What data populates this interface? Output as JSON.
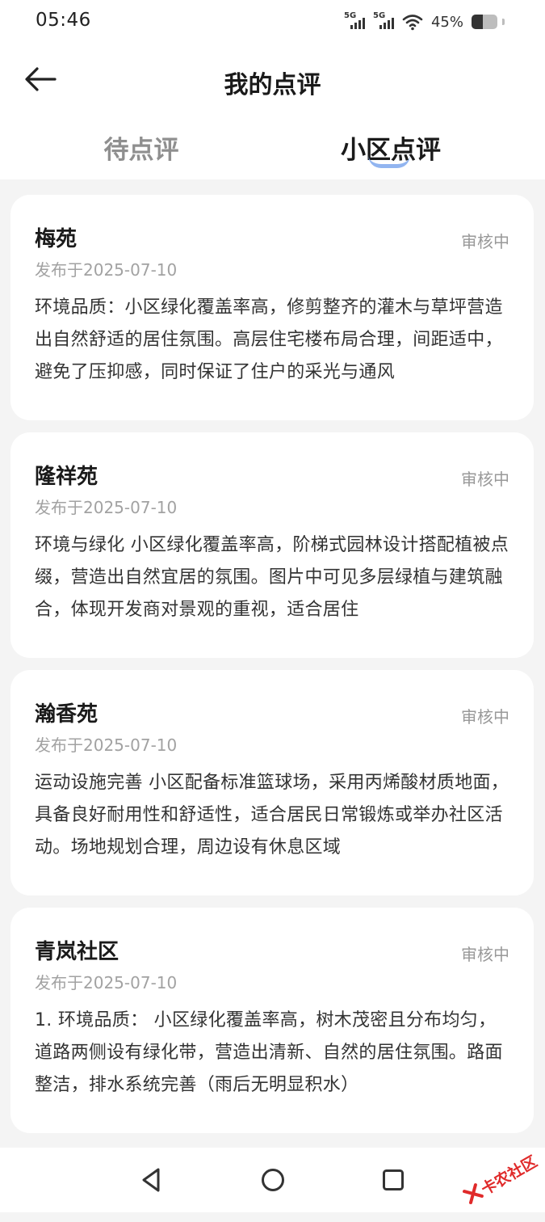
{
  "status_bar": {
    "time": "05:46",
    "signal_1_label": "5G",
    "signal_2_label": "5G",
    "battery_percent": "45%",
    "battery_level": 0.45
  },
  "header": {
    "title": "我的点评",
    "back_icon": "arrow-left-icon"
  },
  "tabs": [
    {
      "label": "待点评",
      "active": false
    },
    {
      "label": "小区点评",
      "active": true
    }
  ],
  "reviews": [
    {
      "name": "梅苑",
      "status": "审核中",
      "date": "发布于2025-07-10",
      "text": "环境品质：小区绿化覆盖率高，修剪整齐的灌木与草坪营造出自然舒适的居住氛围。高层住宅楼布局合理，间距适中，避免了压抑感，同时保证了住户的采光与通风"
    },
    {
      "name": "隆祥苑",
      "status": "审核中",
      "date": "发布于2025-07-10",
      "text": "环境与绿化 小区绿化覆盖率高，阶梯式园林设计搭配植被点缀，营造出自然宜居的氛围。图片中可见多层绿植与建筑融合，体现开发商对景观的重视，适合居住"
    },
    {
      "name": "瀚香苑",
      "status": "审核中",
      "date": "发布于2025-07-10",
      "text": "运动设施完善 小区配备标准篮球场，采用丙烯酸材质地面，具备良好耐用性和舒适性，适合居民日常锻炼或举办社区活动。场地规划合理，周边设有休息区域"
    },
    {
      "name": "青岚社区",
      "status": "审核中",
      "date": "发布于2025-07-10",
      "text": "1. 环境品质： 小区绿化覆盖率高，树木茂密且分布均匀，道路两侧设有绿化带，营造出清新、自然的居住氛围。路面整洁，排水系统完善（雨后无明显积水）"
    }
  ],
  "nav_bar": {
    "back_icon": "triangle-back-icon",
    "home_icon": "circle-home-icon",
    "recent_icon": "square-recent-icon"
  },
  "watermark": {
    "text": "卡农社区",
    "color": "#e02a2a"
  },
  "colors": {
    "accent": "#7fa9ee",
    "background": "#f4f4f4",
    "card": "#ffffff",
    "muted_text": "#999999"
  }
}
